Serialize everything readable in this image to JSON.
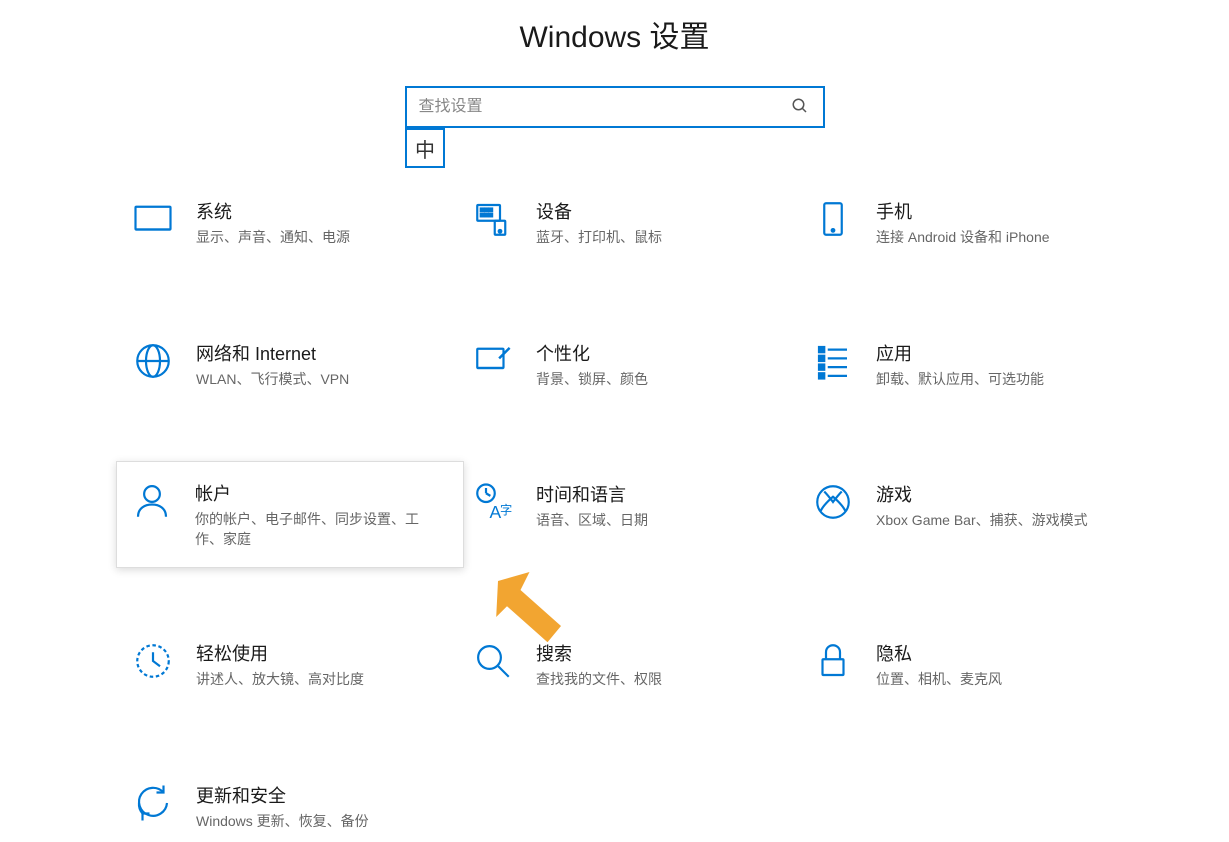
{
  "page_title": "Windows 设置",
  "search": {
    "placeholder": "查找设置"
  },
  "ime_indicator": "中",
  "tiles": [
    {
      "id": "system",
      "title": "系统",
      "desc": "显示、声音、通知、电源"
    },
    {
      "id": "devices",
      "title": "设备",
      "desc": "蓝牙、打印机、鼠标"
    },
    {
      "id": "phone",
      "title": "手机",
      "desc": "连接 Android 设备和 iPhone"
    },
    {
      "id": "network",
      "title": "网络和 Internet",
      "desc": "WLAN、飞行模式、VPN"
    },
    {
      "id": "personalization",
      "title": "个性化",
      "desc": "背景、锁屏、颜色"
    },
    {
      "id": "apps",
      "title": "应用",
      "desc": "卸载、默认应用、可选功能"
    },
    {
      "id": "accounts",
      "title": "帐户",
      "desc": "你的帐户、电子邮件、同步设置、工作、家庭"
    },
    {
      "id": "time-language",
      "title": "时间和语言",
      "desc": "语音、区域、日期"
    },
    {
      "id": "gaming",
      "title": "游戏",
      "desc": "Xbox Game Bar、捕获、游戏模式"
    },
    {
      "id": "ease-of-access",
      "title": "轻松使用",
      "desc": "讲述人、放大镜、高对比度"
    },
    {
      "id": "search-cat",
      "title": "搜索",
      "desc": "查找我的文件、权限"
    },
    {
      "id": "privacy",
      "title": "隐私",
      "desc": "位置、相机、麦克风"
    },
    {
      "id": "update-security",
      "title": "更新和安全",
      "desc": "Windows 更新、恢复、备份"
    }
  ],
  "highlighted_tile": "accounts",
  "colors": {
    "accent": "#0078d4",
    "arrow": "#f2a531"
  }
}
